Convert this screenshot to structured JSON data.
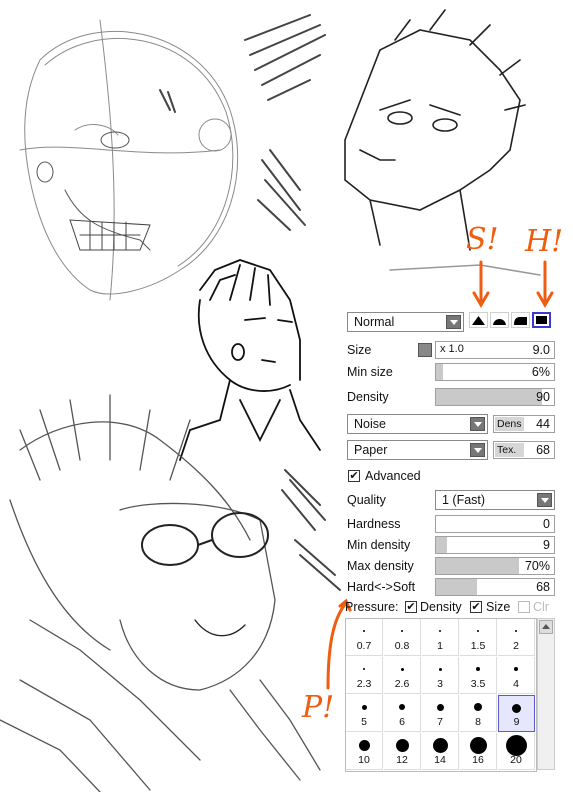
{
  "colors": {
    "accent_annotation": "#ef5d10",
    "selected_border": "#3a3acc",
    "slider_fill": "#c9c9c9"
  },
  "annotations": {
    "soft": "S!",
    "hard": "H!",
    "pressure": "P!"
  },
  "panel": {
    "blend_mode": "Normal",
    "size": {
      "label": "Size",
      "multiplier": "x 1.0",
      "value": "9.0"
    },
    "min_size": {
      "label": "Min size",
      "value": "6%",
      "fraction": 0.06
    },
    "density": {
      "label": "Density",
      "value": "90",
      "fraction": 0.9
    },
    "texture1": {
      "name": "Noise",
      "tag": "Dens",
      "value": "44"
    },
    "texture2": {
      "name": "Paper",
      "tag": "Tex.",
      "value": "68"
    },
    "advanced": {
      "label": "Advanced",
      "checked": true
    },
    "quality": {
      "label": "Quality",
      "value": "1 (Fast)"
    },
    "hardness": {
      "label": "Hardness",
      "value": "0",
      "fraction": 0.0
    },
    "min_density": {
      "label": "Min density",
      "value": "9",
      "fraction": 0.09
    },
    "max_density": {
      "label": "Max density",
      "value": "70%",
      "fraction": 0.7
    },
    "hard_soft": {
      "label": "Hard<->Soft",
      "value": "68",
      "fraction": 0.35
    },
    "pressure": {
      "label": "Pressure:",
      "density": "Density",
      "size": "Size",
      "clr": "Clr"
    },
    "brush_sizes": [
      "0.7",
      "0.8",
      "1",
      "1.5",
      "2",
      "2.3",
      "2.6",
      "3",
      "3.5",
      "4",
      "5",
      "6",
      "7",
      "8",
      "9",
      "10",
      "12",
      "14",
      "16",
      "20"
    ],
    "selected_brush_size": "9"
  }
}
